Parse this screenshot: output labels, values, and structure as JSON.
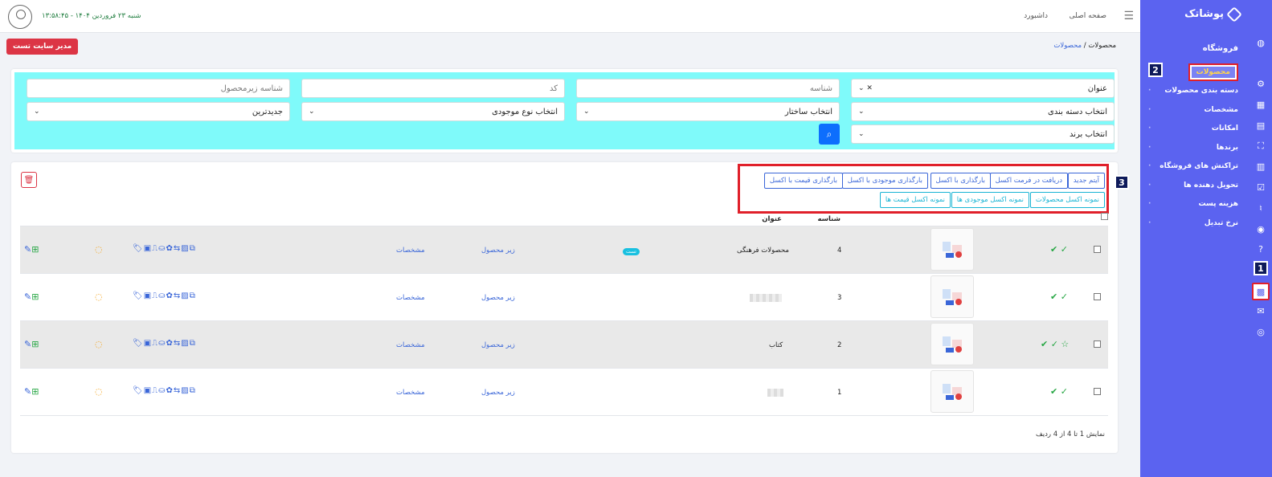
{
  "sidebar": {
    "brand": "پوشاتک",
    "section_title": "فروشگاه",
    "items": [
      {
        "label": "محصولات",
        "active": true
      },
      {
        "label": "دسته بندی محصولات",
        "active": false
      },
      {
        "label": "مشخصات",
        "active": false
      },
      {
        "label": "امکانات",
        "active": false
      },
      {
        "label": "برندها",
        "active": false
      },
      {
        "label": "تراکنش های فروشگاه",
        "active": false
      },
      {
        "label": "تحویل دهنده ها",
        "active": false
      },
      {
        "label": "هزینه پست",
        "active": false
      },
      {
        "label": "نرخ تبدیل",
        "active": false
      }
    ]
  },
  "callouts": {
    "one": "1",
    "two": "2",
    "three": "3"
  },
  "topbar": {
    "home": "صفحه اصلی",
    "dashboard": "داشبورد",
    "datetime": "شنبه ۲۳ فروردین ۱۴۰۴ - ۱۳:۵۸:۴۵"
  },
  "breadcrumb": {
    "current": "محصولات",
    "separator": "/",
    "link": "محصولات"
  },
  "admin_button": "مدیر سایت تست",
  "filters": {
    "title": "عنوان",
    "id_placeholder": "شناسه",
    "code_placeholder": "کد",
    "sub_id_placeholder": "شناسه زیرمحصول",
    "category": "انتخاب دسته بندی",
    "structure": "انتخاب ساختار",
    "stock_type": "انتخاب نوع موجودی",
    "sort": "جدیدترین",
    "brand": "انتخاب برند"
  },
  "toolbar": {
    "new_item": "آیتم جدید",
    "export_excel": "دریافت در فرمت اکسل",
    "import_excel": "بارگذاری با اکسل",
    "import_stock": "بارگذاری موجودی با اکسل",
    "import_price": "بارگذاری قیمت با اکسل",
    "sample_products": "نمونه اکسل محصولات",
    "sample_stock": "نمونه اکسل موجودی ها",
    "sample_price": "نمونه اکسل قیمت ها"
  },
  "table": {
    "headers": {
      "id": "شناسه",
      "title": "عنوان"
    },
    "rows": [
      {
        "id": "4",
        "title": "محصولات فرهنگی",
        "badge": "تست",
        "sub": "زیر محصول",
        "spec": "مشخصات",
        "star": false
      },
      {
        "id": "3",
        "title": "",
        "badge": "",
        "sub": "زیر محصول",
        "spec": "مشخصات",
        "star": false
      },
      {
        "id": "2",
        "title": "کتاب",
        "badge": "",
        "sub": "زیر محصول",
        "spec": "مشخصات",
        "star": true
      },
      {
        "id": "1",
        "title": "",
        "badge": "",
        "sub": "زیر محصول",
        "spec": "مشخصات",
        "star": false
      }
    ],
    "footer": "نمایش 1 تا 4 از 4 ردیف"
  },
  "colors": {
    "primary": "#5b63f0",
    "filter_bg": "#7ffafa",
    "danger": "#dc3545",
    "link": "#3a66d8"
  }
}
